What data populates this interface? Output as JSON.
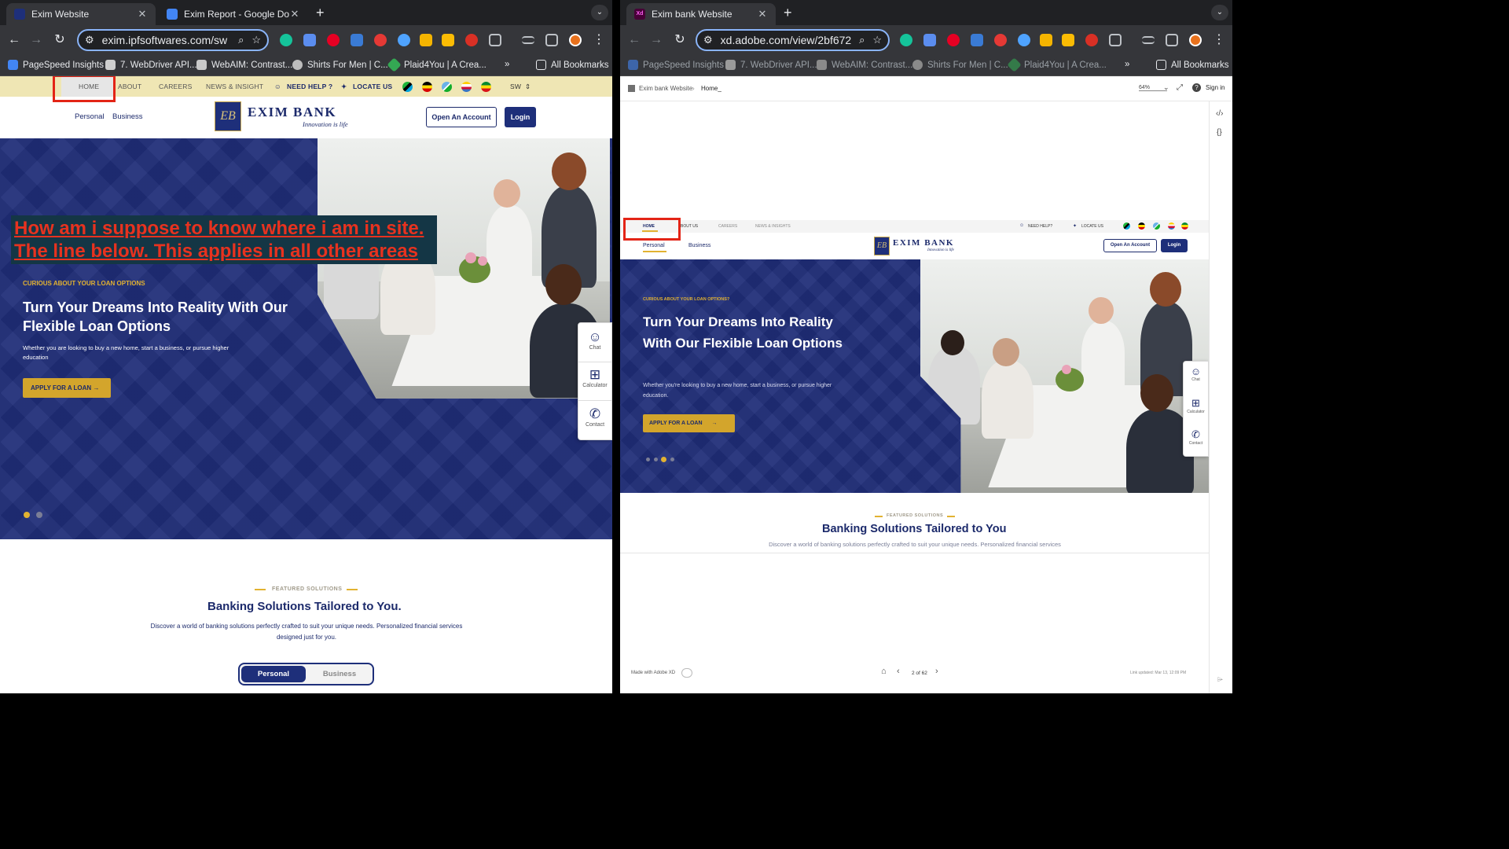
{
  "left_window": {
    "tabs": [
      {
        "title": "Exim Website",
        "favicon_color": "#1e2f7a"
      },
      {
        "title": "Exim Report - Google Docs",
        "favicon_color": "#4285f4"
      }
    ],
    "url": "exim.ipfsoftwares.com/sw",
    "bookmarks": [
      "PageSpeed Insights",
      "7. WebDriver API...",
      "WebAIM: Contrast...",
      "Shirts For Men | C...",
      "Plaid4You | A Crea...",
      "All Bookmarks"
    ],
    "utility_nav": [
      "HOME",
      "ABOUT",
      "CAREERS",
      "NEWS & INSIGHT"
    ],
    "need_help": "NEED HELP ?",
    "locate_us": "LOCATE US",
    "language": "SW",
    "main_nav": [
      "Personal",
      "Business"
    ],
    "logo": {
      "mark": "EB",
      "name": "EXIM BANK",
      "tagline": "Innovation is life"
    },
    "open_account": "Open An Account",
    "login": "Login",
    "annotation": [
      "How am i suppose to know where i am in site.",
      "The line below. This applies in all other areas"
    ],
    "hero": {
      "eyebrow": "CURIOUS ABOUT YOUR LOAN OPTIONS",
      "title": "Turn Your Dreams Into Reality With Our Flexible Loan Options",
      "subtitle": "Whether you are looking to buy a new home, start a business, or pursue higher education",
      "cta": "APPLY FOR A LOAN",
      "slides": 2,
      "active_slide": 1
    },
    "side_panel": [
      "Chat",
      "Calculator",
      "Contact"
    ],
    "featured": {
      "tag": "FEATURED SOLUTIONS",
      "title": "Banking Solutions Tailored to You.",
      "description": "Discover a world of banking solutions perfectly crafted to suit your unique needs. Personalized financial services designed just for you.",
      "toggle": [
        "Personal",
        "Business"
      ]
    }
  },
  "right_window": {
    "tabs": [
      {
        "title": "Exim bank Website",
        "favicon_color": "#470137"
      }
    ],
    "url": "xd.adobe.com/view/2bf672...",
    "bookmarks": [
      "PageSpeed Insights",
      "7. WebDriver API...",
      "WebAIM: Contrast...",
      "Shirts For Men | C...",
      "Plaid4You | A Crea...",
      "All Bookmarks"
    ],
    "breadcrumb": [
      "Exim bank Website",
      "Home_"
    ],
    "zoom": "64%",
    "sign_in": "Sign in",
    "utility_nav": [
      "HOME",
      "BOUT US",
      "CAREERS",
      "NEWS & INSIGHTS"
    ],
    "need_help": "NEED HELP?",
    "locate_us": "LOCATE US",
    "main_nav": [
      "Personal",
      "Business"
    ],
    "logo": {
      "mark": "EB",
      "name": "EXIM BANK",
      "tagline": "Innovation is life"
    },
    "open_account": "Open An Account",
    "login": "Login",
    "hero": {
      "eyebrow": "CURIOUS ABOUT YOUR LOAN OPTIONS?",
      "title": "Turn Your Dreams Into Reality With Our Flexible Loan Options",
      "subtitle": "Whether you're looking to buy a new home, start a business, or pursue higher education.",
      "cta": "APPLY FOR A LOAN",
      "slides": 4,
      "active_slide": 3
    },
    "side_panel": [
      "Chat",
      "Calculator",
      "Contact"
    ],
    "featured": {
      "tag": "FEATURED SOLUTIONS",
      "title": "Banking Solutions Tailored to You",
      "description": "Discover a world of banking solutions perfectly crafted to suit your unique needs. Personalized financial services"
    },
    "made_with": "Made with Adobe XD",
    "pagination": "2 of 62",
    "link_updated": "Link updated: Mar 13, 12:09 PM"
  },
  "colors": {
    "navy": "#1f2d78",
    "gold": "#e2b231",
    "annotation_red": "#e32416",
    "chrome_dark": "#202124"
  }
}
